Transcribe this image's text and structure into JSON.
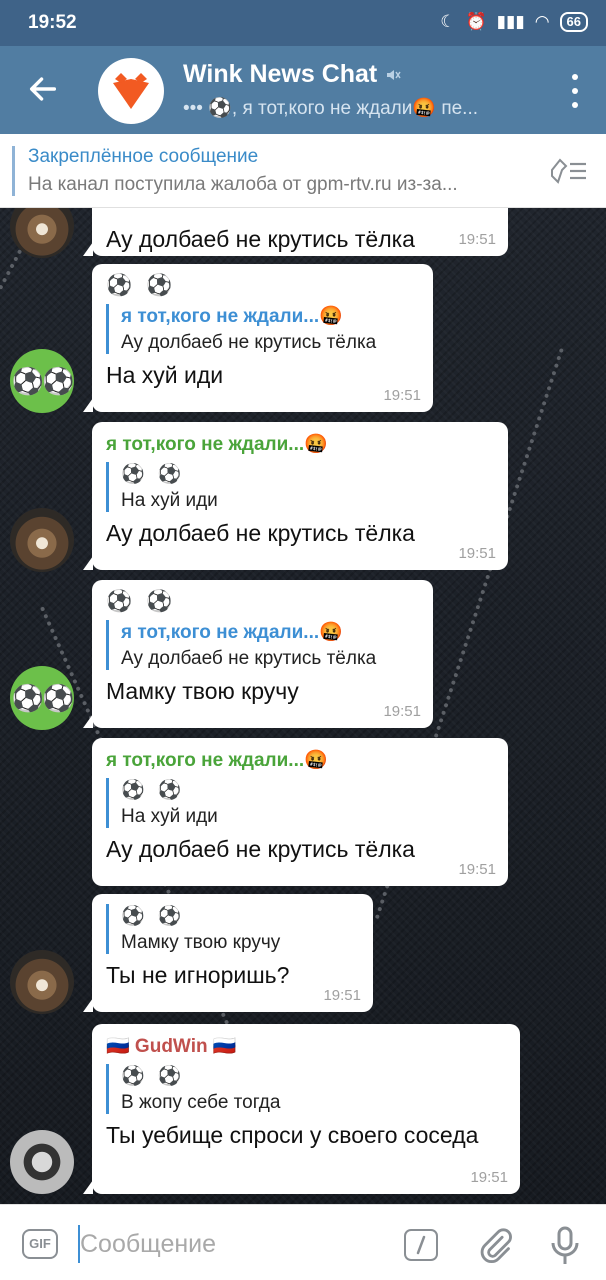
{
  "status_bar": {
    "time": "19:52",
    "battery": "66"
  },
  "header": {
    "title": "Wink News Chat",
    "subtitle": "•••  ⚽, я тот,кого не ждали🤬 пе...",
    "colors": {
      "header": "#517da2",
      "status": "#3f6388"
    }
  },
  "pinned": {
    "title": "Закреплённое сообщение",
    "text": "На канал поступила жалоба от gpm-rtv.ru из-за..."
  },
  "messages": [
    {
      "text": "Ау долбаеб не крутись тёлка",
      "time": "19:51"
    },
    {
      "reply_name": "я тот,кого не ждали...🤬",
      "reply_text": "Ау долбаеб не крутись тёлка",
      "text": "На хуй иди",
      "time": "19:51"
    },
    {
      "sender": "я тот,кого не ждали...🤬",
      "reply_name": "⚽ ⚽",
      "reply_text": "На хуй иди",
      "text": "Ау долбаеб не крутись тёлка",
      "time": "19:51"
    },
    {
      "reply_name": "я тот,кого не ждали...🤬",
      "reply_text": "Ау долбаеб не крутись тёлка",
      "text": "Мамку твою кручу",
      "time": "19:51"
    },
    {
      "sender": "я тот,кого не ждали...🤬",
      "reply_name": "⚽ ⚽",
      "reply_text": "На хуй иди",
      "text": "Ау долбаеб не крутись тёлка",
      "time": "19:51"
    },
    {
      "reply_name": "⚽ ⚽",
      "reply_text": "Мамку твою кручу",
      "text": "Ты не игноришь?",
      "time": "19:51"
    },
    {
      "sender": "🇷🇺 GudWin 🇷🇺",
      "reply_name": "⚽ ⚽",
      "reply_text": "В жопу себе тогда",
      "text": "Ты уебище спроси у своего соседа",
      "time": "19:51"
    }
  ],
  "sender_header": "⚽ ⚽",
  "input": {
    "placeholder": "Сообщение",
    "gif_label": "GIF"
  }
}
